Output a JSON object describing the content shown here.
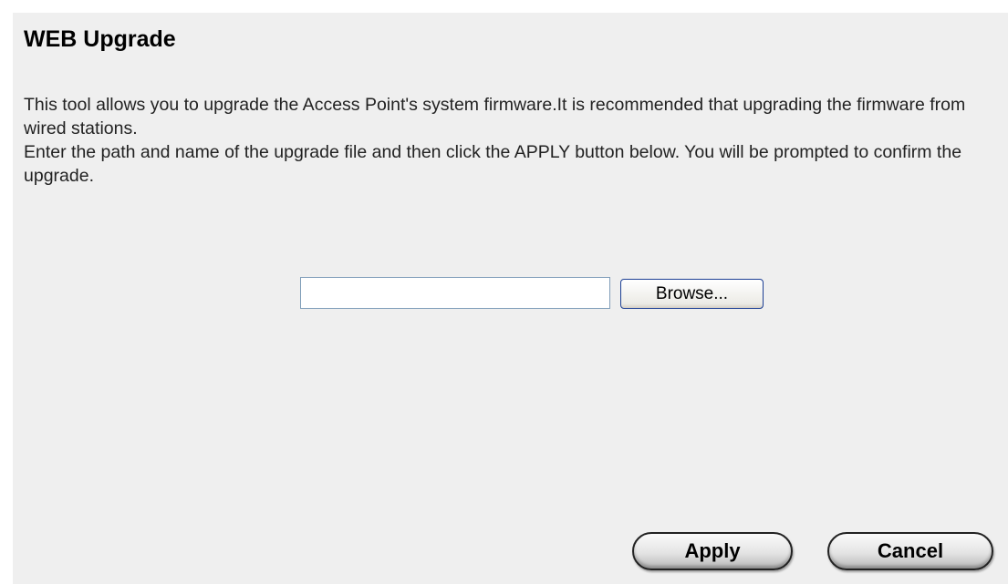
{
  "page": {
    "title": "WEB Upgrade",
    "description": [
      "This tool allows you to upgrade the Access Point's system firmware.It is recommended that upgrading the firmware from wired stations.",
      "Enter the path and name of the upgrade file and then click the APPLY button below. You will be prompted to confirm the upgrade."
    ]
  },
  "upload": {
    "file_value": "",
    "browse_label": "Browse..."
  },
  "actions": {
    "apply_label": "Apply",
    "cancel_label": "Cancel"
  },
  "colors": {
    "panel_background": "#efefef",
    "input_border": "#7f9db9",
    "browse_border": "#1c3f94"
  }
}
